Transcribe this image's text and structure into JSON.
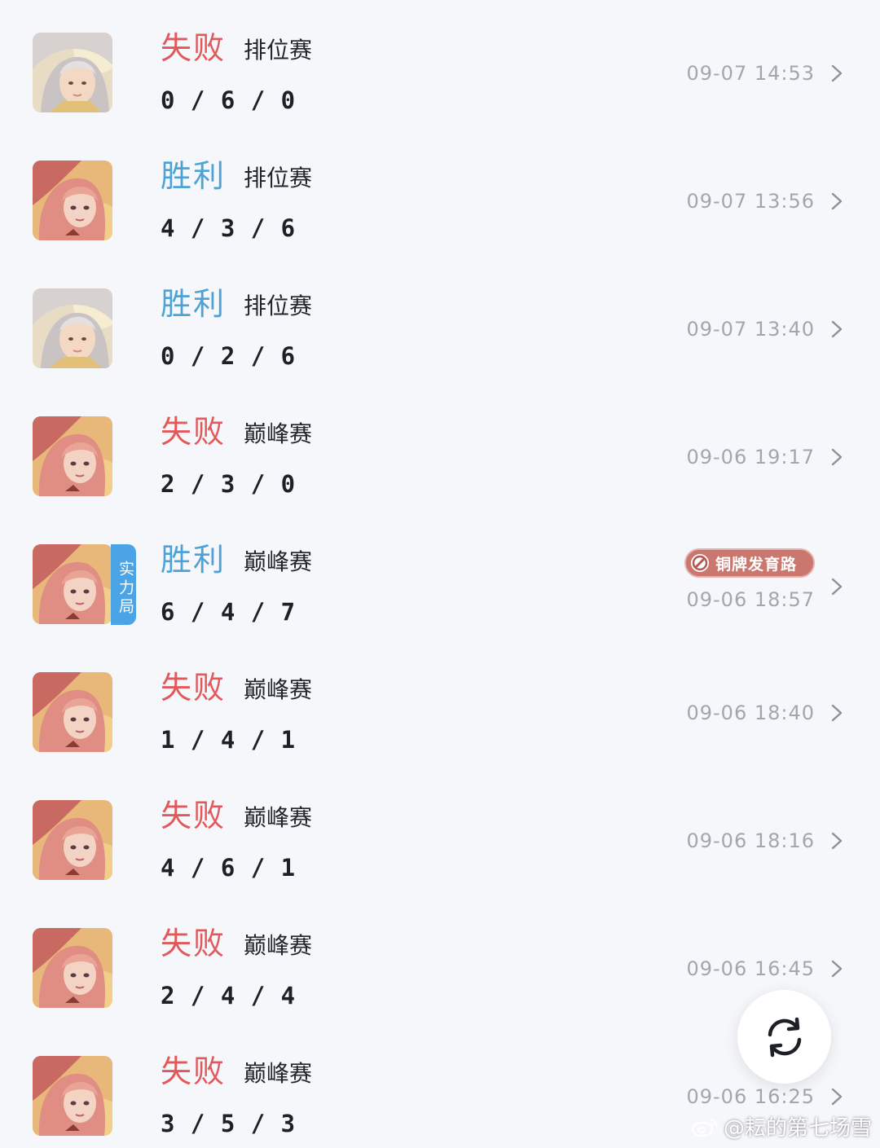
{
  "matches": [
    {
      "result": "失败",
      "result_type": "lose",
      "mode": "排位赛",
      "kda": "0 / 6 / 0",
      "time": "09-07 14:53",
      "hero_icon": "hero-silver-hair-avatar"
    },
    {
      "result": "胜利",
      "result_type": "win",
      "mode": "排位赛",
      "kda": "4 / 3 / 6",
      "time": "09-07 13:56",
      "hero_icon": "hero-pink-hair-avatar"
    },
    {
      "result": "胜利",
      "result_type": "win",
      "mode": "排位赛",
      "kda": "0 / 2 / 6",
      "time": "09-07 13:40",
      "hero_icon": "hero-silver-hair-avatar"
    },
    {
      "result": "失败",
      "result_type": "lose",
      "mode": "巅峰赛",
      "kda": "2 / 3 / 0",
      "time": "09-06 19:17",
      "hero_icon": "hero-pink-hair-avatar"
    },
    {
      "result": "胜利",
      "result_type": "win",
      "mode": "巅峰赛",
      "kda": "6 / 4 / 7",
      "time": "09-06 18:57",
      "hero_icon": "hero-pink-hair-avatar",
      "tag": "实力局",
      "badge": "铜牌发育路"
    },
    {
      "result": "失败",
      "result_type": "lose",
      "mode": "巅峰赛",
      "kda": "1 / 4 / 1",
      "time": "09-06 18:40",
      "hero_icon": "hero-pink-hair-avatar"
    },
    {
      "result": "失败",
      "result_type": "lose",
      "mode": "巅峰赛",
      "kda": "4 / 6 / 1",
      "time": "09-06 18:16",
      "hero_icon": "hero-pink-hair-avatar"
    },
    {
      "result": "失败",
      "result_type": "lose",
      "mode": "巅峰赛",
      "kda": "2 / 4 / 4",
      "time": "09-06 16:45",
      "hero_icon": "hero-pink-hair-avatar"
    },
    {
      "result": "失败",
      "result_type": "lose",
      "mode": "巅峰赛",
      "kda": "3 / 5 / 3",
      "time": "09-06 16:25",
      "hero_icon": "hero-pink-hair-avatar"
    }
  ],
  "colors": {
    "lose": "#e2595c",
    "win": "#4da2d6",
    "tag": "#4aa4e6",
    "badge": "#c9776f",
    "background": "#f6f7fb"
  },
  "refresh": {
    "icon": "refresh-icon"
  },
  "watermark": {
    "icon": "weibo-icon",
    "text": "@耘的第七场雪"
  }
}
